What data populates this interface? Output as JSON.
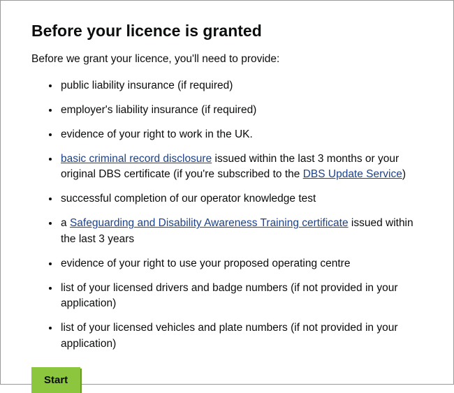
{
  "heading": "Before your licence is granted",
  "intro": "Before we grant your licence, you'll need to provide:",
  "items": [
    {
      "type": "text",
      "text": "public liability insurance (if required)"
    },
    {
      "type": "text",
      "text": "employer's liability insurance (if required)"
    },
    {
      "type": "text",
      "text": "evidence of your right to work in the UK."
    },
    {
      "type": "rich",
      "parts": [
        {
          "kind": "link",
          "text": "basic criminal record disclosure"
        },
        {
          "kind": "text",
          "text": " issued within the last 3 months or your original DBS certificate (if you're subscribed to the "
        },
        {
          "kind": "link",
          "text": "DBS Update Service"
        },
        {
          "kind": "text",
          "text": ")"
        }
      ]
    },
    {
      "type": "text",
      "text": "successful completion of our operator knowledge test"
    },
    {
      "type": "rich",
      "parts": [
        {
          "kind": "text",
          "text": "a "
        },
        {
          "kind": "link",
          "text": "Safeguarding and Disability Awareness Training certificate"
        },
        {
          "kind": "text",
          "text": " issued within the last 3 years"
        }
      ]
    },
    {
      "type": "text",
      "text": "evidence of your right to use your proposed operating centre"
    },
    {
      "type": "text",
      "text": "list of your licensed drivers and badge numbers (if not provided in your application)"
    },
    {
      "type": "text",
      "text": "list of your licensed vehicles and plate numbers (if not provided in your application)"
    }
  ],
  "start_label": "Start"
}
